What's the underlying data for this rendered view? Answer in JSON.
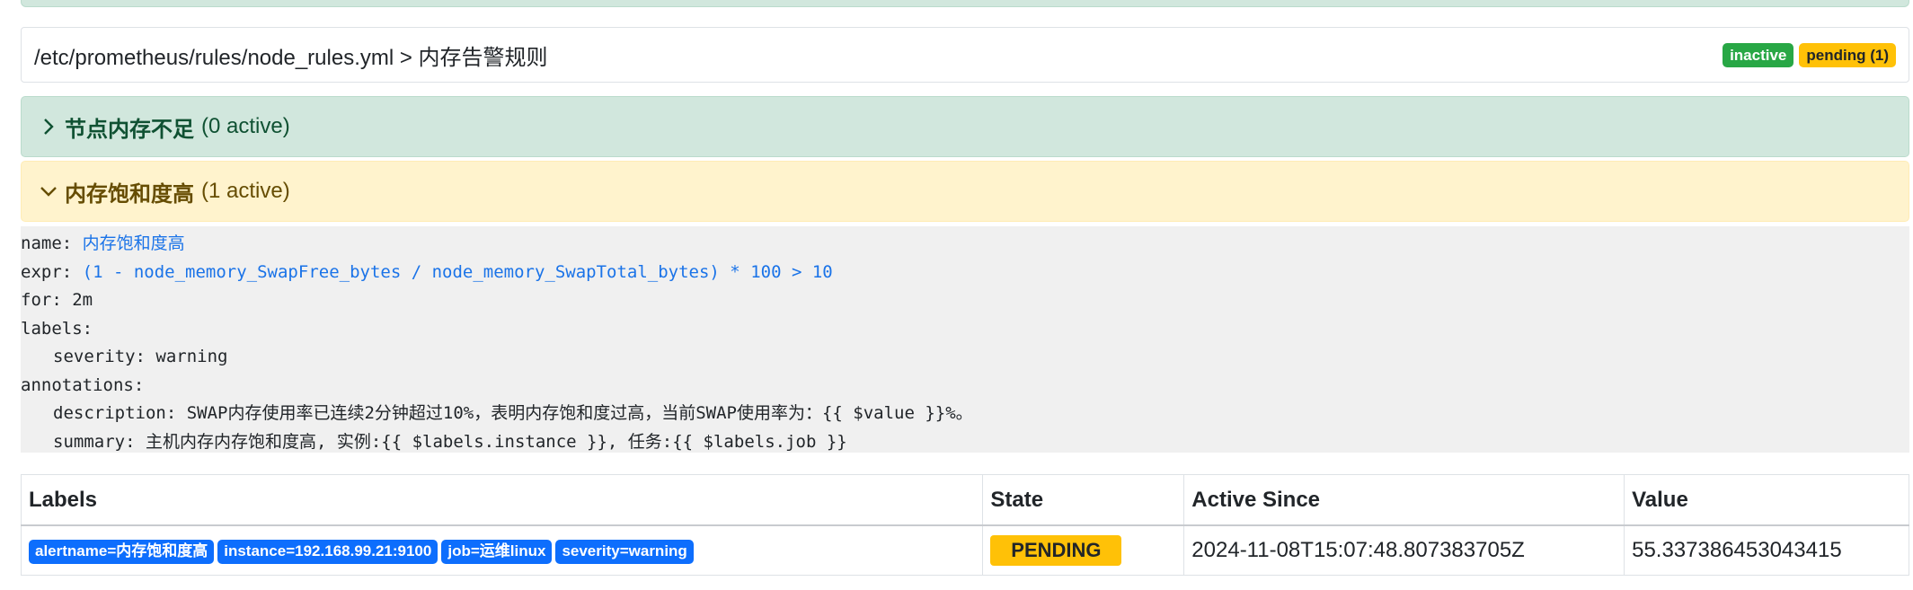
{
  "group": {
    "title": "/etc/prometheus/rules/node_rules.yml > 内存告警规则",
    "badge_inactive": "inactive",
    "badge_pending": "pending (1)"
  },
  "rules": [
    {
      "name": "节点内存不足",
      "count": "(0 active)",
      "state": "inactive",
      "expanded": false
    },
    {
      "name": "内存饱和度高",
      "count": "(1 active)",
      "state": "pending",
      "expanded": true
    }
  ],
  "rule_detail": {
    "name_key": "name:",
    "name_value": "内存饱和度高",
    "expr_key": "expr:",
    "expr_value": "(1 - node_memory_SwapFree_bytes / node_memory_SwapTotal_bytes) * 100 > 10",
    "for_line": "for: 2m",
    "labels_line": "labels:",
    "severity_line": "severity: warning",
    "annotations_line": "annotations:",
    "description_line": "description: SWAP内存使用率已连续2分钟超过10%，表明内存饱和度过高，当前SWAP使用率为：{{ $value }}%。",
    "summary_line": "summary: 主机内存内存饱和度高, 实例:{{ $labels.instance }}, 任务:{{ $labels.job }}"
  },
  "table": {
    "headers": [
      "Labels",
      "State",
      "Active Since",
      "Value"
    ],
    "rows": [
      {
        "labels": [
          "alertname=内存饱和度高",
          "instance=192.168.99.21:9100",
          "job=运维linux",
          "severity=warning"
        ],
        "state": "PENDING",
        "active_since": "2024-11-08T15:07:48.807383705Z",
        "value": "55.337386453043415"
      }
    ]
  },
  "colors": {
    "inactive_bg": "#d1e7dd",
    "pending_bg": "#fff3cd",
    "badge_green": "#28a745",
    "badge_yellow": "#ffc107",
    "label_blue": "#0d6efd"
  },
  "icons": {
    "collapsed": "chevron-right-icon",
    "expanded": "chevron-down-icon"
  }
}
